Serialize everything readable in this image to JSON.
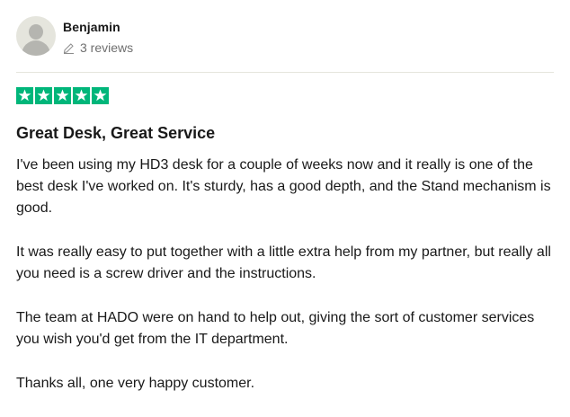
{
  "reviewer": {
    "name": "Benjamin",
    "review_count": "3 reviews"
  },
  "rating": {
    "stars": 5,
    "max": 5,
    "color": "#00b67a"
  },
  "review": {
    "title": "Great Desk, Great Service",
    "paragraphs": [
      "I've been using my HD3 desk for a couple of weeks now and it really is one of the best desk I've worked on. It's sturdy, has a good depth, and the Stand mechanism is good.",
      "It was really easy to put together with a little extra help from my partner, but really all you need is a screw driver and the instructions.",
      "The team at HADO were on hand to help out, giving the sort of customer services you wish you'd get from the IT department.",
      "Thanks all, one very happy customer."
    ]
  },
  "icons": {
    "avatar": "avatar-placeholder-icon",
    "reviews": "pencil-icon",
    "star": "star-icon"
  }
}
